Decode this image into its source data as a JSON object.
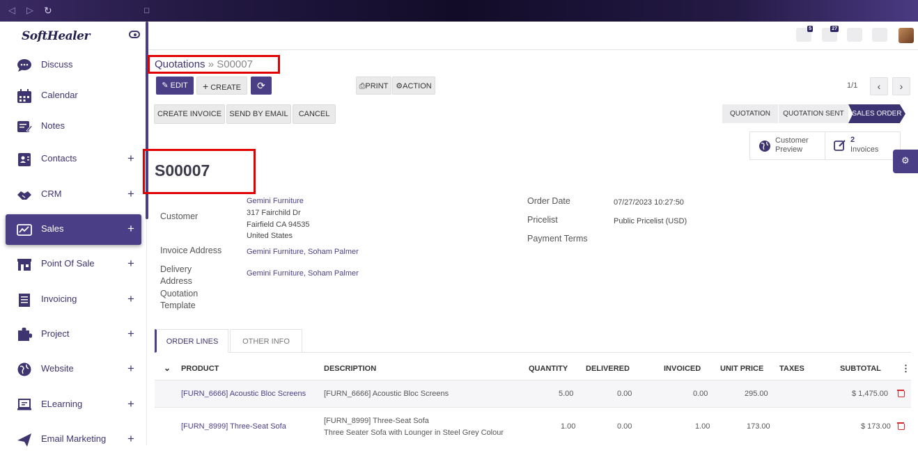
{
  "browser": {
    "back": "◁",
    "forward": "▷",
    "reload": "↻",
    "sidebar_toggle": "◻"
  },
  "sidebar": {
    "logo": "SoftHealer",
    "items": [
      {
        "label": "Discuss",
        "icon": "chat-icon",
        "has_plus": false
      },
      {
        "label": "Calendar",
        "icon": "calendar-icon",
        "has_plus": false
      },
      {
        "label": "Notes",
        "icon": "notes-icon",
        "has_plus": false
      },
      {
        "label": "Contacts",
        "icon": "contacts-icon",
        "has_plus": true,
        "plus": "+"
      },
      {
        "label": "CRM",
        "icon": "handshake-icon",
        "has_plus": true,
        "plus": "+"
      },
      {
        "label": "Sales",
        "icon": "chart-line-icon",
        "has_plus": true,
        "plus": "+",
        "active": true
      },
      {
        "label": "Point Of Sale",
        "icon": "shop-icon",
        "has_plus": true,
        "plus": "+"
      },
      {
        "label": "Invoicing",
        "icon": "invoice-icon",
        "has_plus": true,
        "plus": "+"
      },
      {
        "label": "Project",
        "icon": "puzzle-icon",
        "has_plus": true,
        "plus": "+"
      },
      {
        "label": "Website",
        "icon": "globe-icon",
        "has_plus": true,
        "plus": "+"
      },
      {
        "label": "ELearning",
        "icon": "elearning-icon",
        "has_plus": true,
        "plus": "+"
      },
      {
        "label": "Email Marketing",
        "icon": "paper-plane-icon",
        "has_plus": true,
        "plus": "+"
      }
    ]
  },
  "header": {
    "messages_count": "5",
    "activities_count": "27"
  },
  "breadcrumb": {
    "parent": "Quotations",
    "separator": "»",
    "current": "S00007"
  },
  "toolbar": {
    "edit": "EDIT",
    "create": "CREATE",
    "print": "PRINT",
    "action": "ACTION"
  },
  "pager": {
    "value": "1/1",
    "prev": "‹",
    "next": "›"
  },
  "status_buttons": {
    "create_invoice": "CREATE INVOICE",
    "send_by_email": "SEND BY EMAIL",
    "cancel": "CANCEL"
  },
  "stages": {
    "quotation": "QUOTATION",
    "quotation_sent": "QUOTATION SENT",
    "sales_order": "SALES ORDER"
  },
  "smart_buttons": {
    "preview_line1": "Customer",
    "preview_line2": "Preview",
    "invoices_count": "2",
    "invoices_label": "Invoices"
  },
  "record": {
    "name": "S00007",
    "customer_label": "Customer",
    "customer_name": "Gemini Furniture",
    "customer_address1": "317 Fairchild Dr",
    "customer_address2": "Fairfield CA 94535",
    "customer_address3": "United States",
    "invoice_address_label": "Invoice Address",
    "invoice_address": "Gemini Furniture, Soham Palmer",
    "delivery_address_label1": "Delivery",
    "delivery_address_label2": "Address",
    "delivery_address": "Gemini Furniture, Soham Palmer",
    "quotation_template_label1": "Quotation",
    "quotation_template_label2": "Template",
    "order_date_label": "Order Date",
    "order_date": "07/27/2023 10:27:50",
    "pricelist_label": "Pricelist",
    "pricelist": "Public Pricelist (USD)",
    "payment_terms_label": "Payment Terms"
  },
  "tabs": {
    "order_lines": "ORDER LINES",
    "other_info": "OTHER INFO"
  },
  "table": {
    "headers": {
      "product": "PRODUCT",
      "description": "DESCRIPTION",
      "quantity": "QUANTITY",
      "delivered": "DELIVERED",
      "invoiced": "INVOICED",
      "unit_price": "UNIT PRICE",
      "taxes": "TAXES",
      "subtotal": "SUBTOTAL"
    },
    "rows": [
      {
        "product": "[FURN_6666] Acoustic Bloc Screens",
        "description": "[FURN_6666] Acoustic Bloc Screens",
        "description2": "",
        "quantity": "5.00",
        "delivered": "0.00",
        "invoiced": "0.00",
        "unit_price": "295.00",
        "taxes": "",
        "subtotal": "$ 1,475.00"
      },
      {
        "product": "[FURN_8999] Three-Seat Sofa",
        "description": "[FURN_8999] Three-Seat Sofa",
        "description2": "Three Seater Sofa with Lounger in Steel Grey Colour",
        "quantity": "1.00",
        "delivered": "0.00",
        "invoiced": "1.00",
        "unit_price": "173.00",
        "taxes": "",
        "subtotal": "$ 173.00"
      }
    ]
  }
}
